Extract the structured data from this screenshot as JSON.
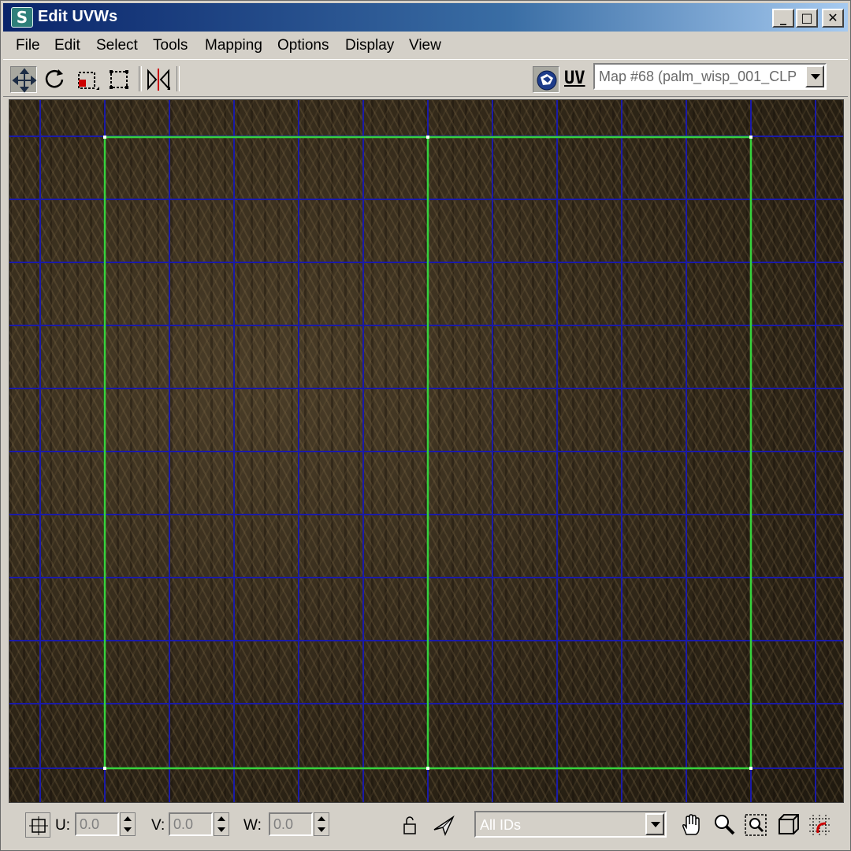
{
  "window": {
    "title": "Edit UVWs",
    "app_icon_glyph": "S",
    "controls": {
      "minimize": "_",
      "maximize": "□",
      "close": "✕"
    }
  },
  "menu": [
    "File",
    "Edit",
    "Select",
    "Tools",
    "Mapping",
    "Options",
    "Display",
    "View"
  ],
  "toolbar": {
    "tools": [
      "move-icon",
      "rotate-icon",
      "scale-icon",
      "freeform-icon",
      "mirror-icon"
    ],
    "uv_label": "UV",
    "map_dropdown": "Map #68 (palm_wisp_001_CLP"
  },
  "viewport": {
    "texture": "palm_wisp_001_CLP",
    "grid_color": "#1a1aa8",
    "selection_color": "#36d23c"
  },
  "statusbar": {
    "u_label": "U:",
    "u_value": "0.0",
    "v_label": "V:",
    "v_value": "0.0",
    "w_label": "W:",
    "w_value": "0.0",
    "id_filter": "All IDs",
    "tools": [
      "lock-icon",
      "soft-select-icon",
      "pan-icon",
      "zoom-icon",
      "zoom-region-icon",
      "zoom-extents-icon",
      "grid-snap-icon"
    ]
  }
}
